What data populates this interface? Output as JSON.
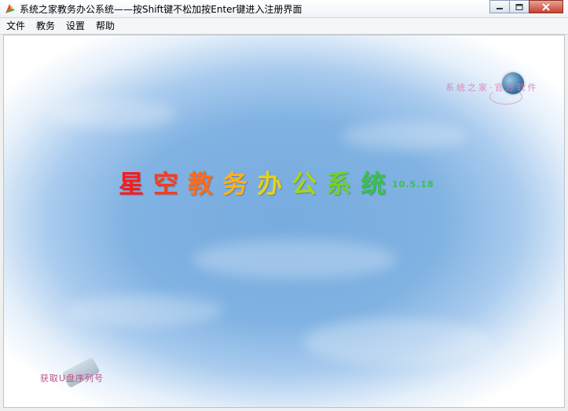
{
  "window": {
    "title": "系统之家教务办公系统——按Shift键不松加按Enter键进入注册界面"
  },
  "menu": {
    "items": [
      "文件",
      "教务",
      "设置",
      "帮助"
    ]
  },
  "splash": {
    "title_chars": [
      "星",
      "空",
      "教",
      "务",
      "办",
      "公",
      "系",
      "统"
    ],
    "title_colors": [
      "#ff1a1a",
      "#ff3b1a",
      "#ff6a1a",
      "#ffb01a",
      "#e6d21a",
      "#a8d41a",
      "#6ed12a",
      "#39c24a"
    ],
    "version": "10.5.18",
    "logo_text": "系统之家·官方软件",
    "usb_text": "获取U盘序列号"
  },
  "icons": [
    "app-icon",
    "minimize-icon",
    "maximize-icon",
    "close-icon",
    "globe-logo-icon",
    "usb-drive-icon"
  ]
}
